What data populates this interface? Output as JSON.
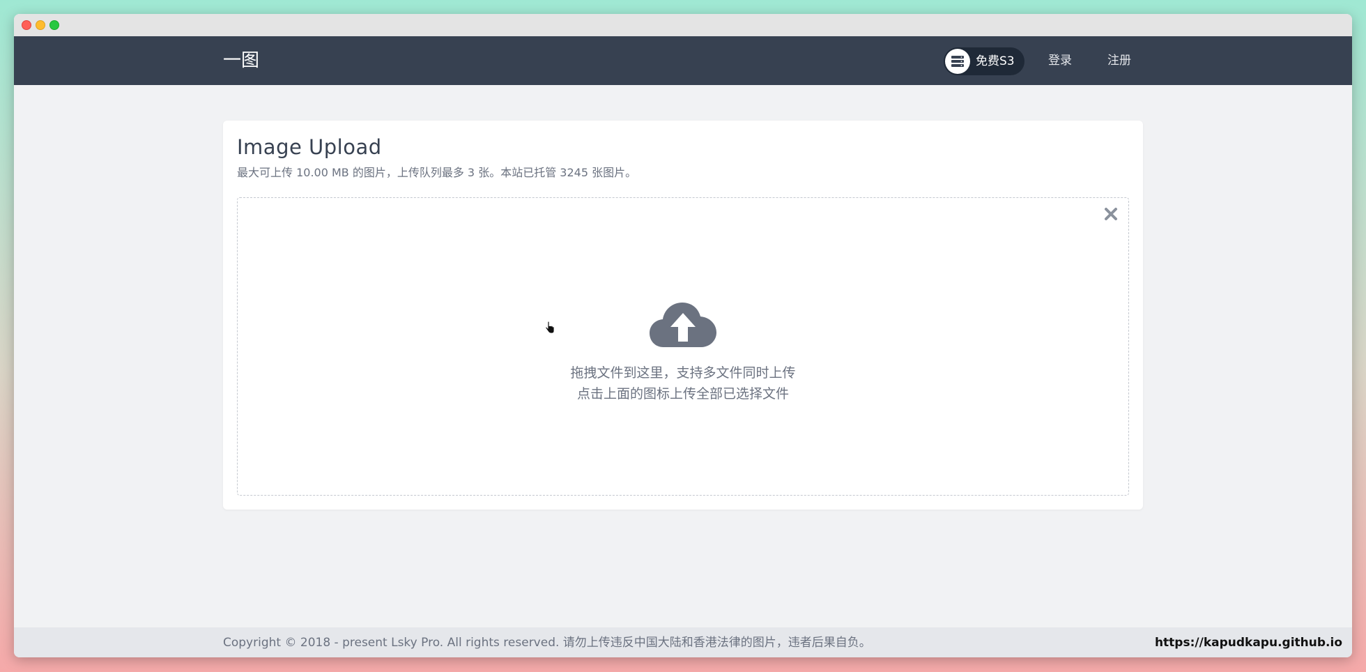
{
  "window": {
    "controls": [
      "close",
      "minimize",
      "maximize"
    ]
  },
  "navbar": {
    "logo": "一图",
    "s3_label": "免费S3",
    "s3_icon": "server-icon",
    "login": "登录",
    "register": "注册"
  },
  "upload": {
    "title": "Image Upload",
    "subtitle": "最大可上传 10.00 MB 的图片，上传队列最多 3 张。本站已托管 3245 张图片。",
    "hint_line1": "拖拽文件到这里，支持多文件同时上传",
    "hint_line2": "点击上面的图标上传全部已选择文件",
    "upload_icon": "cloud-upload-icon",
    "close_icon": "close-icon"
  },
  "footer": {
    "copyright": "Copyright © 2018 - present Lsky Pro. All rights reserved.   请勿上传违反中国大陆和香港法律的图片，违者后果自负。",
    "watermark": "https://kapudkapu.github.io"
  },
  "colors": {
    "navbar_bg": "#374151",
    "page_bg": "#f1f2f4",
    "icon_gray": "#6b7280"
  }
}
